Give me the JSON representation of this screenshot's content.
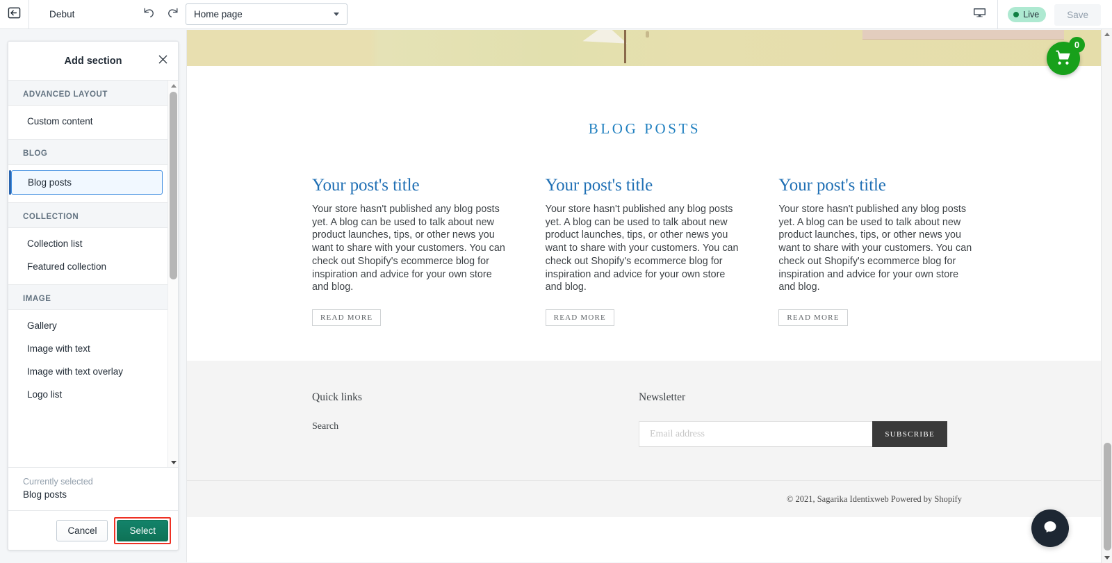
{
  "topbar": {
    "back_icon": "back-arrow-icon",
    "theme_name": "Debut",
    "undo_icon": "undo-icon",
    "redo_icon": "redo-icon",
    "page_selector": {
      "value": "Home page"
    },
    "device_icon": "desktop-icon",
    "live_label": "Live",
    "save_label": "Save"
  },
  "sidebar": {
    "title": "Add section",
    "close_icon": "close-icon",
    "groups": [
      {
        "heading": "ADVANCED LAYOUT",
        "items": [
          {
            "label": "Custom content",
            "selected": false
          }
        ]
      },
      {
        "heading": "BLOG",
        "items": [
          {
            "label": "Blog posts",
            "selected": true
          }
        ]
      },
      {
        "heading": "COLLECTION",
        "items": [
          {
            "label": "Collection list",
            "selected": false
          },
          {
            "label": "Featured collection",
            "selected": false
          }
        ]
      },
      {
        "heading": "IMAGE",
        "items": [
          {
            "label": "Gallery",
            "selected": false
          },
          {
            "label": "Image with text",
            "selected": false
          },
          {
            "label": "Image with text overlay",
            "selected": false
          },
          {
            "label": "Logo list",
            "selected": false
          }
        ]
      }
    ],
    "footer": {
      "currently_selected_label": "Currently selected",
      "currently_selected_value": "Blog posts",
      "cancel_label": "Cancel",
      "select_label": "Select",
      "select_highlight_color": "#ee3124",
      "select_button_color": "#0e7256"
    }
  },
  "preview": {
    "cart": {
      "icon": "shopping-cart-icon",
      "count": "0",
      "color": "#18a01b"
    },
    "blog": {
      "section_title": "BLOG POSTS",
      "title_color": "#1f7fbf",
      "posts": [
        {
          "title": "Your post's title",
          "body": "Your store hasn't published any blog posts yet. A blog can be used to talk about new product launches, tips, or other news you want to share with your customers. You can check out Shopify's ecommerce blog for inspiration and advice for your own store and blog.",
          "cta": "READ MORE"
        },
        {
          "title": "Your post's title",
          "body": "Your store hasn't published any blog posts yet. A blog can be used to talk about new product launches, tips, or other news you want to share with your customers. You can check out Shopify's ecommerce blog for inspiration and advice for your own store and blog.",
          "cta": "READ MORE"
        },
        {
          "title": "Your post's title",
          "body": "Your store hasn't published any blog posts yet. A blog can be used to talk about new product launches, tips, or other news you want to share with your customers. You can check out Shopify's ecommerce blog for inspiration and advice for your own store and blog.",
          "cta": "READ MORE"
        }
      ]
    },
    "footer": {
      "quick_links_heading": "Quick links",
      "quick_links": [
        "Search"
      ],
      "newsletter_heading": "Newsletter",
      "newsletter_placeholder": "Email address",
      "newsletter_value": "",
      "subscribe_label": "SUBSCRIBE",
      "copyright": "© 2021, Sagarika Identixweb Powered by Shopify"
    },
    "chat_icon": "chat-bubble-icon"
  }
}
